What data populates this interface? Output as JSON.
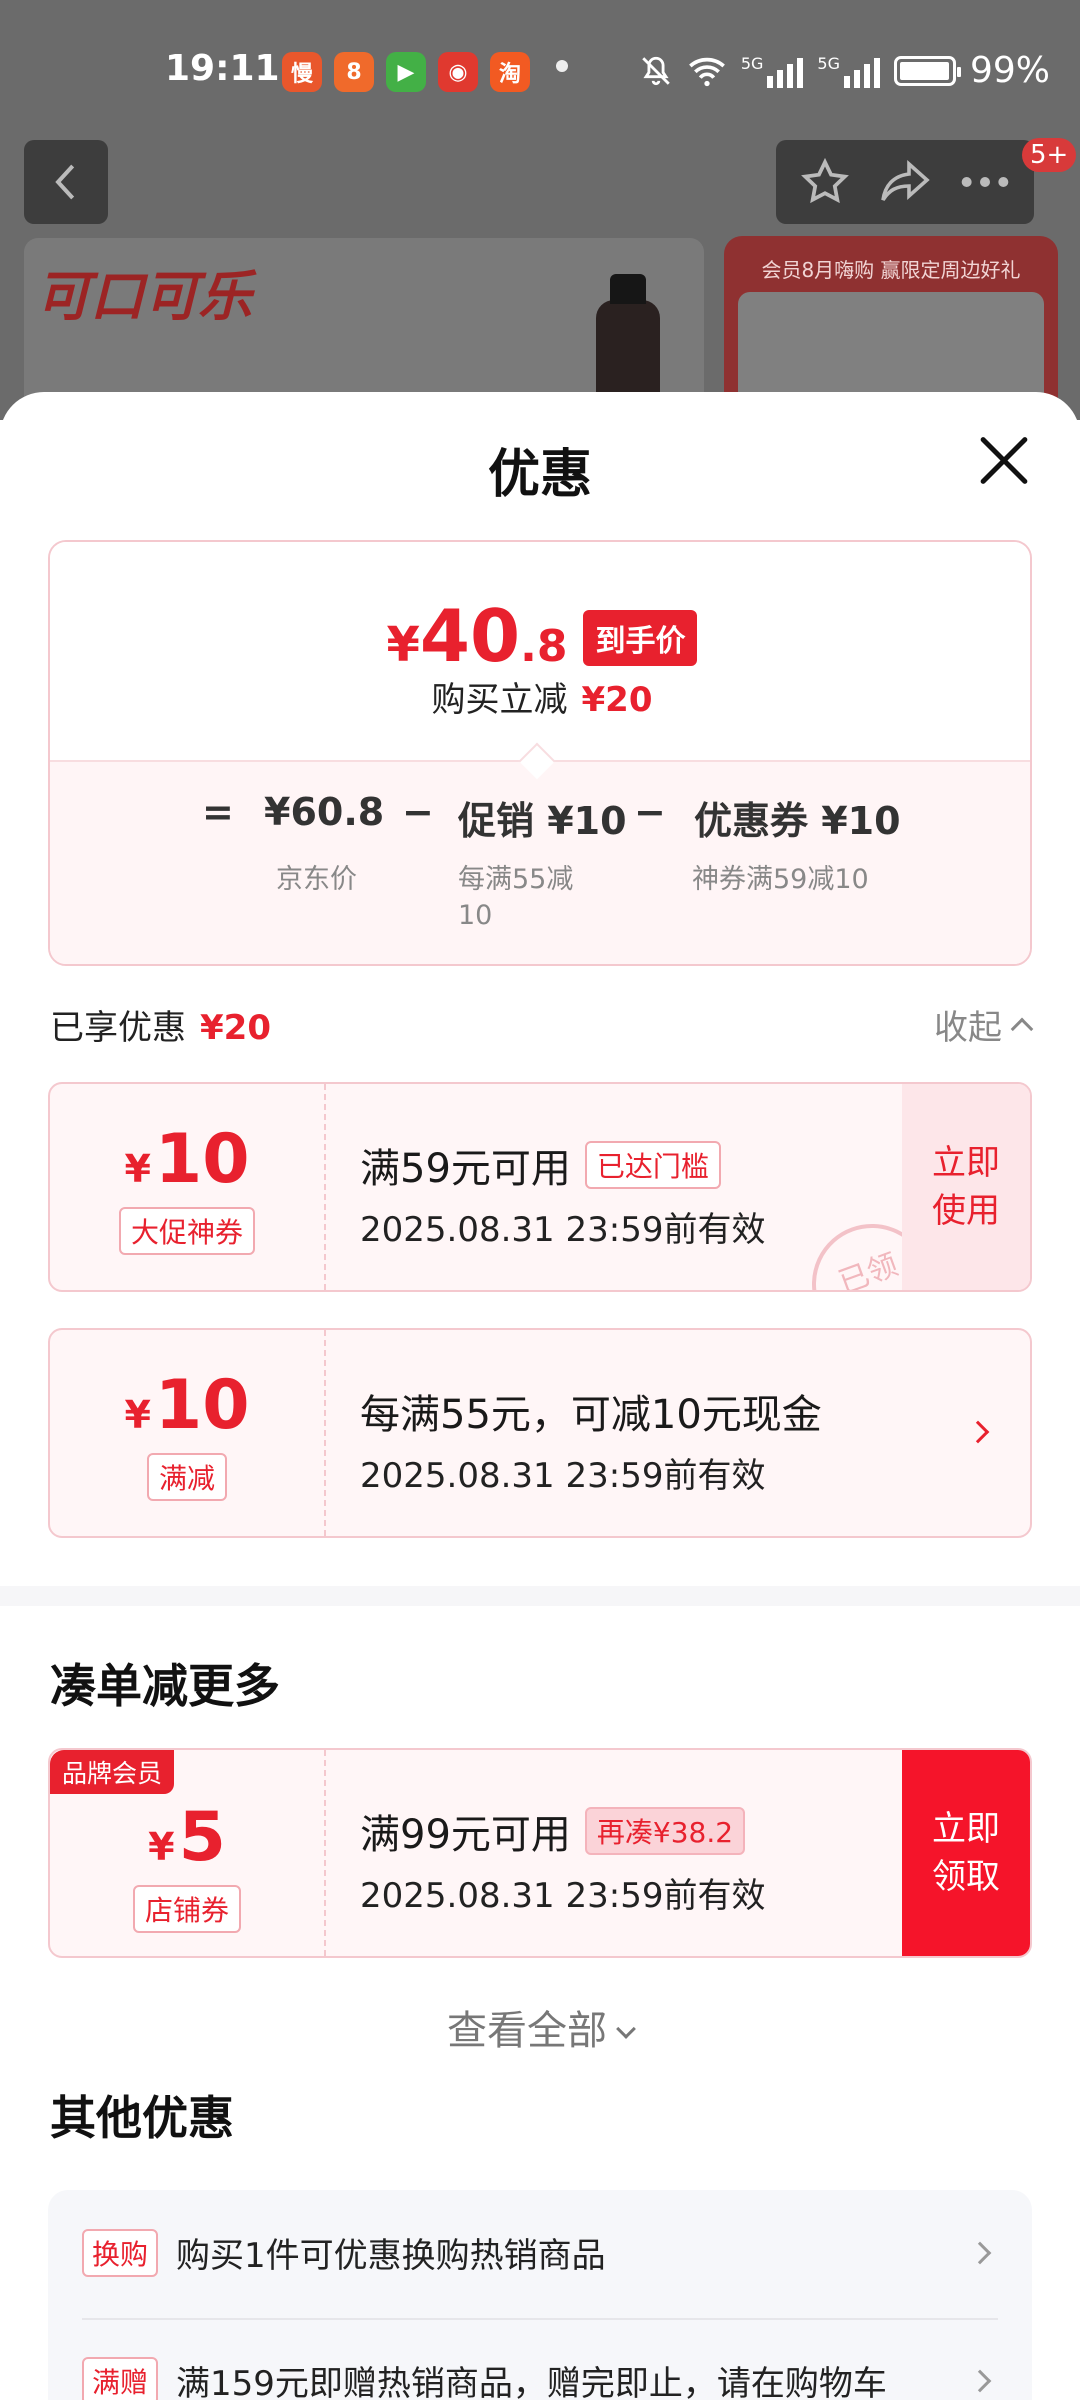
{
  "status_bar": {
    "time": "19:11",
    "apps": [
      {
        "icon": "manbo-app-icon",
        "glyph": "慢",
        "color": "#e9572c"
      },
      {
        "icon": "meituan-app-icon",
        "glyph": "8",
        "color": "#f06a2b"
      },
      {
        "icon": "video-app-icon",
        "glyph": "▶",
        "color": "#43b046"
      },
      {
        "icon": "shopping-app-icon",
        "glyph": "◉",
        "color": "#e0392f"
      },
      {
        "icon": "taobao-app-icon",
        "glyph": "淘",
        "color": "#f25a22"
      }
    ],
    "network": "5G",
    "battery": "99%"
  },
  "header": {
    "badge": "5+"
  },
  "background": {
    "brand_logo": "可口可乐",
    "promo_text": "会员8月嗨购 赢限定周边好礼"
  },
  "sheet": {
    "title": "优惠",
    "summary": {
      "currency": "¥",
      "price_int": "40",
      "price_dec": ".8",
      "price_tag": "到手价",
      "reduce_label": "购买立减",
      "reduce_value": "¥20",
      "formula": {
        "eq": "=",
        "minus1": "−",
        "minus2": "−",
        "item1": "¥60.8",
        "item1_sub": "京东价",
        "item2": "促销 ¥10",
        "item2_sub_line1": "每满55减",
        "item2_sub_line2": "10",
        "item3": "优惠券 ¥10",
        "item3_sub": "神券满59减10"
      }
    },
    "enjoyed_label": "已享优惠",
    "enjoyed_value": "¥20",
    "collapse_label": "收起",
    "coupons": [
      {
        "currency": "¥",
        "amount": "10",
        "tag": "大促神券",
        "condition": "满59元可用",
        "status_pill": "已达门槛",
        "expiry": "2025.08.31 23:59前有效",
        "action_line1": "立即",
        "action_line2": "使用",
        "stamp": "已领"
      },
      {
        "currency": "¥",
        "amount": "10",
        "tag": "满减",
        "condition": "每满55元，可减10元现金",
        "expiry": "2025.08.31 23:59前有效"
      }
    ],
    "more_section": {
      "title": "凑单减更多",
      "coupon": {
        "brand_tag": "品牌会员",
        "currency": "¥",
        "amount": "5",
        "tag": "店铺券",
        "condition": "满99元可用",
        "status_pill": "再凑¥38.2",
        "expiry": "2025.08.31 23:59前有效",
        "action_line1": "立即",
        "action_line2": "领取"
      },
      "view_all": "查看全部"
    },
    "other_section": {
      "title": "其他优惠",
      "items": [
        {
          "tag": "换购",
          "text": "购买1件可优惠换购热销商品"
        },
        {
          "tag": "满赠",
          "text": "满159元即赠热销商品，赠完即止，请在购物车"
        }
      ]
    }
  }
}
